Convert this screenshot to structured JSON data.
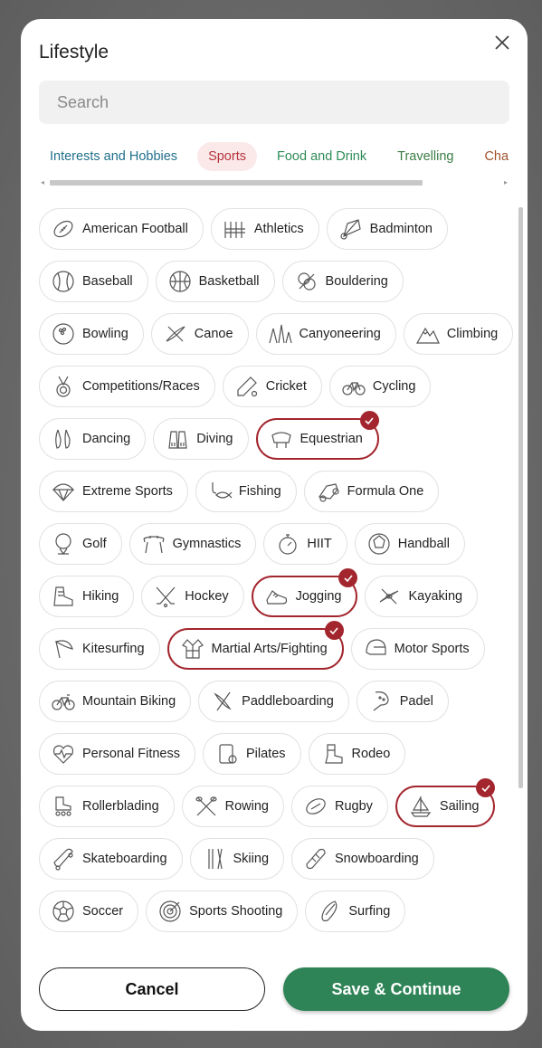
{
  "modal": {
    "title": "Lifestyle",
    "search_placeholder": "Search"
  },
  "tabs": [
    {
      "label": "Interests and Hobbies",
      "active": false
    },
    {
      "label": "Sports",
      "active": true
    },
    {
      "label": "Food and Drink",
      "active": false
    },
    {
      "label": "Travelling",
      "active": false
    },
    {
      "label": "Chara",
      "active": false
    }
  ],
  "sports": [
    [
      {
        "label": "American Football",
        "icon": "american-football-icon",
        "selected": false
      },
      {
        "label": "Athletics",
        "icon": "athletics-hurdles-icon",
        "selected": false
      },
      {
        "label": "Badminton",
        "icon": "shuttlecock-icon",
        "selected": false
      }
    ],
    [
      {
        "label": "Baseball",
        "icon": "baseball-icon",
        "selected": false
      },
      {
        "label": "Basketball",
        "icon": "basketball-icon",
        "selected": false
      },
      {
        "label": "Bouldering",
        "icon": "rope-icon",
        "selected": false
      }
    ],
    [
      {
        "label": "Bowling",
        "icon": "bowling-ball-icon",
        "selected": false
      },
      {
        "label": "Canoe",
        "icon": "canoe-icon",
        "selected": false
      },
      {
        "label": "Canyoneering",
        "icon": "canyon-icon",
        "selected": false
      },
      {
        "label": "Climbing",
        "icon": "mountain-icon",
        "selected": false
      }
    ],
    [
      {
        "label": "Competitions/Races",
        "icon": "medal-icon",
        "selected": false
      },
      {
        "label": "Cricket",
        "icon": "cricket-bat-icon",
        "selected": false
      },
      {
        "label": "Cycling",
        "icon": "bicycle-icon",
        "selected": false
      }
    ],
    [
      {
        "label": "Dancing",
        "icon": "ballet-shoes-icon",
        "selected": false
      },
      {
        "label": "Diving",
        "icon": "flippers-icon",
        "selected": false
      },
      {
        "label": "Equestrian",
        "icon": "saddle-icon",
        "selected": true
      }
    ],
    [
      {
        "label": "Extreme Sports",
        "icon": "parachute-icon",
        "selected": false
      },
      {
        "label": "Fishing",
        "icon": "fish-hook-icon",
        "selected": false
      },
      {
        "label": "Formula One",
        "icon": "race-car-icon",
        "selected": false
      }
    ],
    [
      {
        "label": "Golf",
        "icon": "golf-ball-icon",
        "selected": false
      },
      {
        "label": "Gymnastics",
        "icon": "pommel-horse-icon",
        "selected": false
      },
      {
        "label": "HIIT",
        "icon": "stopwatch-icon",
        "selected": false
      },
      {
        "label": "Handball",
        "icon": "handball-icon",
        "selected": false
      }
    ],
    [
      {
        "label": "Hiking",
        "icon": "hiking-boot-icon",
        "selected": false
      },
      {
        "label": "Hockey",
        "icon": "hockey-sticks-icon",
        "selected": false
      },
      {
        "label": "Jogging",
        "icon": "running-shoe-icon",
        "selected": true
      },
      {
        "label": "Kayaking",
        "icon": "kayak-icon",
        "selected": false
      }
    ],
    [
      {
        "label": "Kitesurfing",
        "icon": "kite-icon",
        "selected": false
      },
      {
        "label": "Martial Arts/Fighting",
        "icon": "gi-uniform-icon",
        "selected": true
      },
      {
        "label": "Motor Sports",
        "icon": "helmet-icon",
        "selected": false
      }
    ],
    [
      {
        "label": "Mountain Biking",
        "icon": "mountain-bike-icon",
        "selected": false
      },
      {
        "label": "Paddleboarding",
        "icon": "paddleboard-icon",
        "selected": false
      },
      {
        "label": "Padel",
        "icon": "padel-racket-icon",
        "selected": false
      }
    ],
    [
      {
        "label": "Personal Fitness",
        "icon": "heartbeat-icon",
        "selected": false
      },
      {
        "label": "Pilates",
        "icon": "yoga-mat-icon",
        "selected": false
      },
      {
        "label": "Rodeo",
        "icon": "cowboy-boot-icon",
        "selected": false
      }
    ],
    [
      {
        "label": "Rollerblading",
        "icon": "rollerblade-icon",
        "selected": false
      },
      {
        "label": "Rowing",
        "icon": "oars-icon",
        "selected": false
      },
      {
        "label": "Rugby",
        "icon": "rugby-ball-icon",
        "selected": false
      },
      {
        "label": "Sailing",
        "icon": "sailboat-icon",
        "selected": true
      }
    ],
    [
      {
        "label": "Skateboarding",
        "icon": "skateboard-icon",
        "selected": false
      },
      {
        "label": "Skiing",
        "icon": "skis-icon",
        "selected": false
      },
      {
        "label": "Snowboarding",
        "icon": "snowboard-icon",
        "selected": false
      }
    ],
    [
      {
        "label": "Soccer",
        "icon": "soccer-ball-icon",
        "selected": false
      },
      {
        "label": "Sports Shooting",
        "icon": "target-icon",
        "selected": false
      },
      {
        "label": "Surfing",
        "icon": "surfboard-icon",
        "selected": false
      }
    ]
  ],
  "footer": {
    "cancel_label": "Cancel",
    "save_label": "Save & Continue"
  },
  "colors": {
    "selected_border": "#a3262e",
    "save_button": "#2e8456",
    "chip_border": "#e2e2e2"
  }
}
